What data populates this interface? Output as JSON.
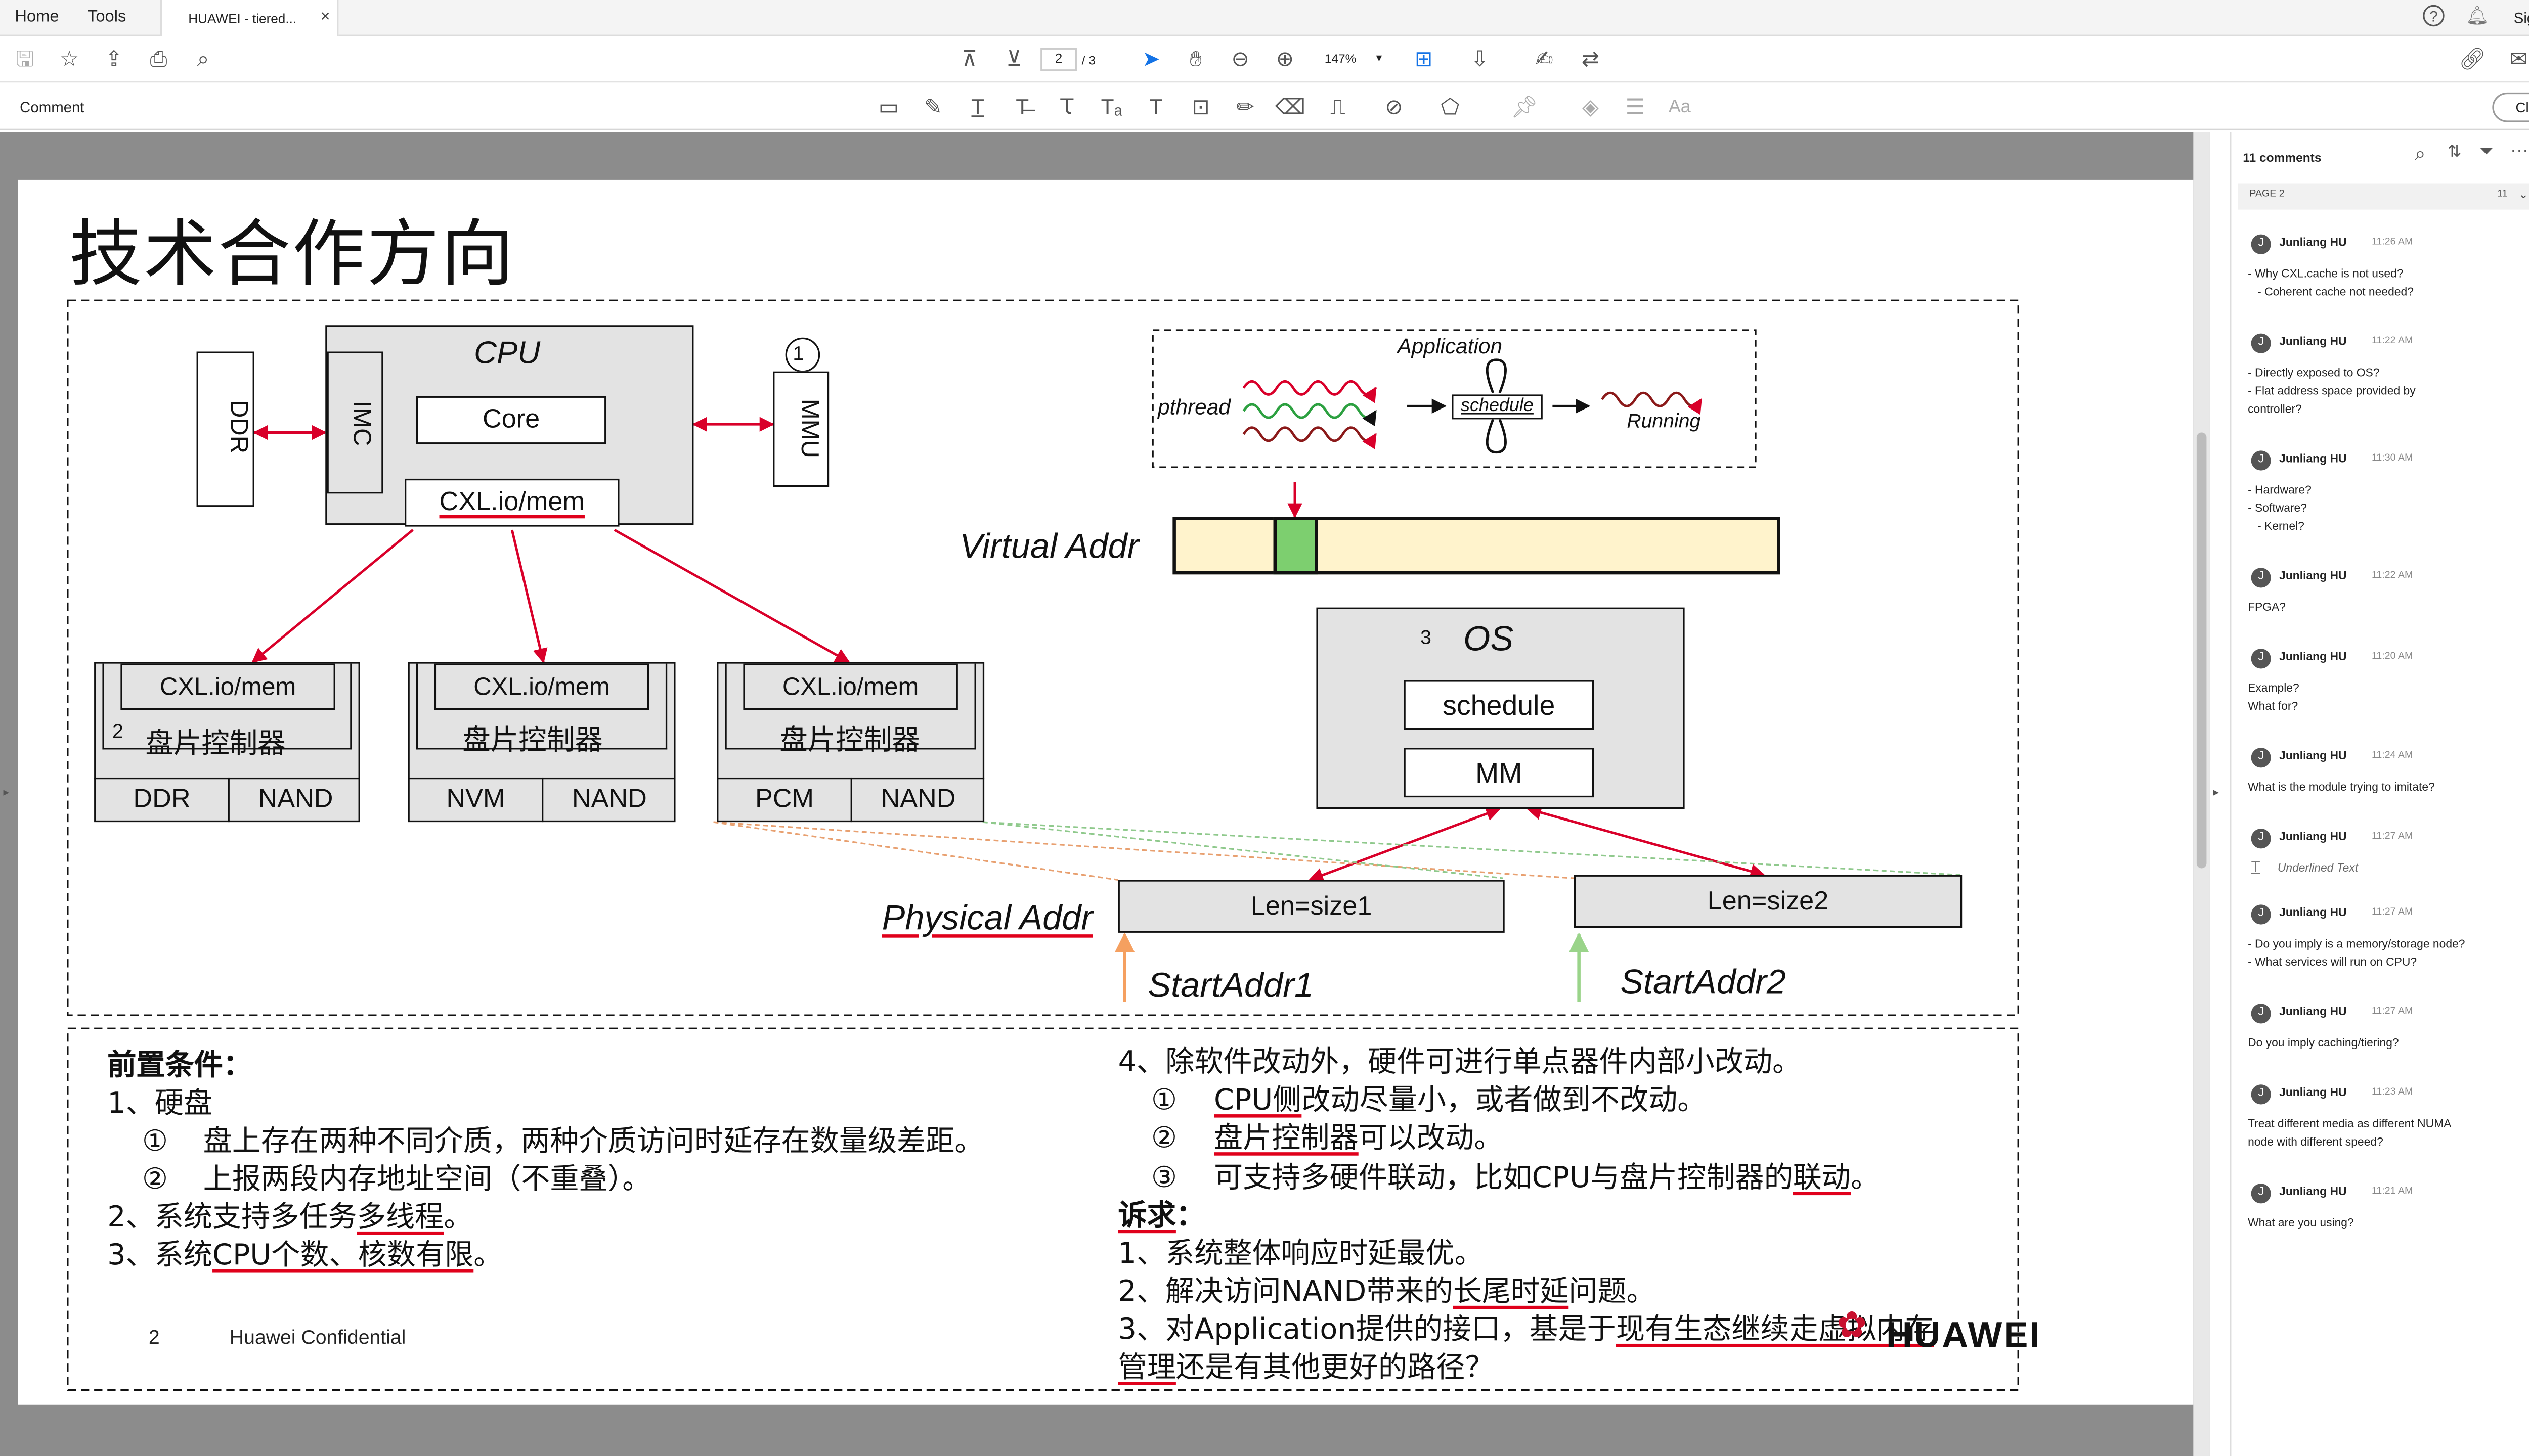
{
  "app": {
    "tabs": {
      "home": "Home",
      "tools": "Tools",
      "doc": "HUAWEI - tiered..."
    },
    "sign_in": "Sign In",
    "page_current": "2",
    "page_total": "/ 3",
    "zoom": "147%",
    "comment_label": "Comment",
    "close_label": "Close"
  },
  "icons": {
    "toolbar": [
      "save-icon",
      "bookmark-star-icon",
      "upload-icon",
      "print-icon",
      "zoom-out-search-icon",
      "page-up-icon",
      "page-down-icon",
      "cursor-icon",
      "hand-icon",
      "zoom-minus-icon",
      "zoom-plus-icon",
      "fit-page-icon",
      "read-mode-icon",
      "sign-icon",
      "share-icon",
      "link-icon",
      "mail-icon",
      "user-add-icon"
    ],
    "comment_tools": [
      "sticky-note-icon",
      "highlight-icon",
      "underline-text-icon",
      "strikethrough-icon",
      "replace-text-icon",
      "insert-text-icon",
      "add-text-icon",
      "textbox-icon",
      "pencil-icon",
      "eraser-icon",
      "stamp-icon",
      "attach-icon",
      "shapes-icon",
      "pin-icon",
      "fill-icon",
      "lines-icon",
      "font-icon"
    ],
    "rail": [
      "export-pdf-icon",
      "create-pdf-icon",
      "organize-icon",
      "edit-pdf-icon",
      "sign-icon",
      "request-sign-icon",
      "excel-icon",
      "scan-icon",
      "comment-icon",
      "print-production-icon",
      "protect-icon",
      "more-tools-icon"
    ]
  },
  "slide": {
    "title": "技术合作方向",
    "diagram": {
      "ddr": "DDR",
      "imc": "IMC",
      "cpu": "CPU",
      "core": "Core",
      "cxl_mem": "CXL.io/mem",
      "mmu": "MMU",
      "num1": "1",
      "num2": "2",
      "num3": "3",
      "controllers": [
        {
          "cxl": "CXL.io/mem",
          "name": "盘片控制器",
          "left": "DDR",
          "right": "NAND"
        },
        {
          "cxl": "CXL.io/mem",
          "name": "盘片控制器",
          "left": "NVM",
          "right": "NAND"
        },
        {
          "cxl": "CXL.io/mem",
          "name": "盘片控制器",
          "left": "PCM",
          "right": "NAND"
        }
      ],
      "application": "Application",
      "pthread": "pthread",
      "schedule_app": "schedule",
      "running": "Running",
      "virtual_addr": "Virtual Addr",
      "os": "OS",
      "schedule": "schedule",
      "mm": "MM",
      "physical_addr": "Physical Addr",
      "len1": "Len=size1",
      "len2": "Len=size2",
      "start1": "StartAddr1",
      "start2": "StartAddr2"
    },
    "left_text": {
      "heading": "前置条件：",
      "l1": "1、硬盘",
      "l1a_num": "①",
      "l1a": "盘上存在两种不同介质，两种介质访问时延存在数量级差距。",
      "l1b_num": "②",
      "l1b": "上报两段内存地址空间（不重叠）。",
      "l2a": "2、系统支持多任务",
      "l2b": "多线程",
      "l2c": "。",
      "l3a": "3、系统",
      "l3b": "CPU个数、核数有限",
      "l3c": "。"
    },
    "right_text": {
      "l4": "4、除软件改动外，硬件可进行单点器件内部小改动。",
      "n1": "①",
      "r1a": "CPU侧",
      "r1b": "改动尽量小，或者做到不改动。",
      "n2": "②",
      "r2a": "盘片控制器",
      "r2b": "可以改动。",
      "n3": "③",
      "r3a": "可支持多硬件联动，比如CPU与盘片控制器的",
      "r3b": "联动",
      "r3c": "。",
      "heading": "诉求",
      "heading_colon": "：",
      "q1": "1、系统整体响应时延最优。",
      "q2a": "2、解决访问NAND带来的",
      "q2b": "长尾时延",
      "q2c": "问题。",
      "q3a": "3、对Application提供的接口，基是于",
      "q3b": "现有生态继续走虚拟内存",
      "q4a": "管理",
      "q4b": "还是有其他更好的路径？"
    },
    "footer": {
      "page": "2",
      "confidential": "Huawei Confidential",
      "logo": "HUAWEI"
    }
  },
  "comments": {
    "count": "11 comments",
    "page_label": "PAGE 2",
    "page_count": "11",
    "items": [
      {
        "author": "Junliang HU",
        "time": "11:26 AM",
        "body": "- Why CXL.cache is not used?\n   - Coherent cache not needed?"
      },
      {
        "author": "Junliang HU",
        "time": "11:22 AM",
        "body": "- Directly exposed to OS?\n- Flat address space provided by\ncontroller?"
      },
      {
        "author": "Junliang HU",
        "time": "11:30 AM",
        "body": "- Hardware?\n- Software?\n   - Kernel?"
      },
      {
        "author": "Junliang HU",
        "time": "11:22 AM",
        "body": "FPGA?"
      },
      {
        "author": "Junliang HU",
        "time": "11:20 AM",
        "body": "Example?\nWhat for?"
      },
      {
        "author": "Junliang HU",
        "time": "11:24 AM",
        "body": "What is the module trying to imitate?"
      },
      {
        "author": "Junliang HU",
        "time": "11:27 AM",
        "body": "Underlined Text"
      },
      {
        "author": "Junliang HU",
        "time": "11:27 AM",
        "body": "- Do you imply is a memory/storage node?\n- What services will run on CPU?"
      },
      {
        "author": "Junliang HU",
        "time": "11:27 AM",
        "body": "Do you imply caching/tiering?"
      },
      {
        "author": "Junliang HU",
        "time": "11:23 AM",
        "body": "Treat different media as different NUMA\nnode with different speed?"
      },
      {
        "author": "Junliang HU",
        "time": "11:21 AM",
        "body": "What are you using?"
      }
    ]
  },
  "colors": {
    "accent_red": "#e0001b",
    "arrow_red": "#d9002a",
    "teal": "#1d7f9e",
    "virt_fill": "#fff3cc",
    "virt_sel": "#7dcf6f",
    "comment_active": "#ffd200"
  }
}
